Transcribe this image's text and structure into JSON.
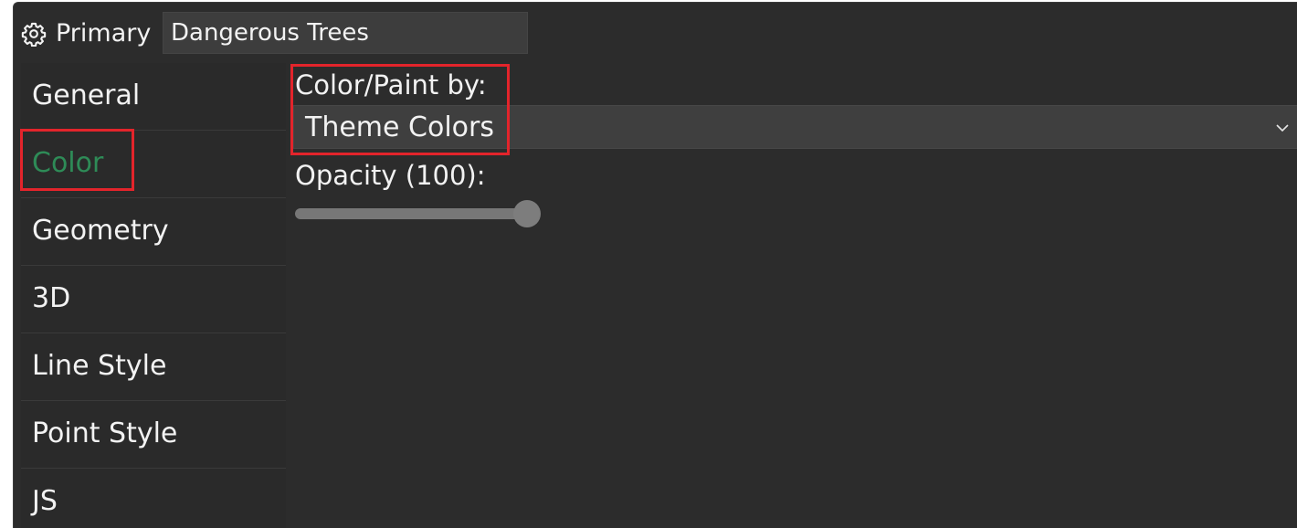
{
  "header": {
    "icon": "gear-icon",
    "label": "Primary",
    "layer_name": "Dangerous Trees"
  },
  "sidebar": {
    "items": [
      {
        "label": "General",
        "active": false
      },
      {
        "label": "Color",
        "active": true
      },
      {
        "label": "Geometry",
        "active": false
      },
      {
        "label": "3D",
        "active": false
      },
      {
        "label": "Line Style",
        "active": false
      },
      {
        "label": "Point Style",
        "active": false
      },
      {
        "label": "JS",
        "active": false
      }
    ]
  },
  "color_panel": {
    "paint_label": "Color/Paint by:",
    "paint_value": "Theme Colors",
    "opacity_label": "Opacity (100):",
    "opacity_value": 100
  },
  "colors": {
    "active_item": "#2e8b57",
    "highlight": "#e3242b"
  }
}
